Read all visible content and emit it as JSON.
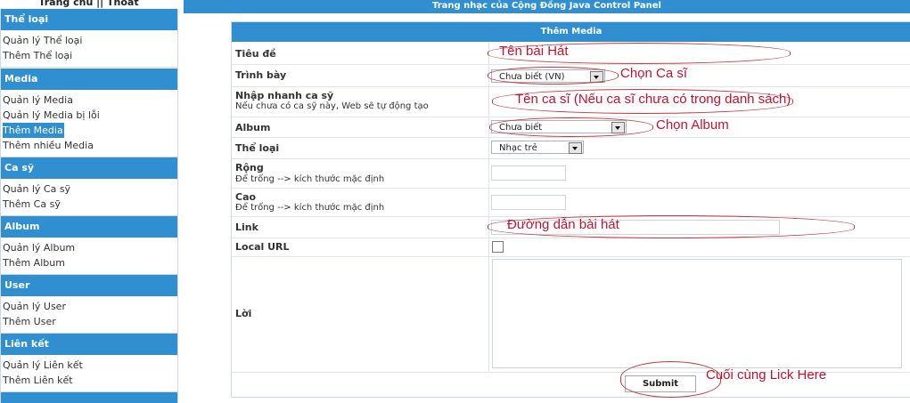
{
  "topnav": {
    "home": "Trang chủ",
    "sep": " || ",
    "logout": "Thoát"
  },
  "sidebar": {
    "sections": [
      {
        "title": "Thể loại",
        "items": [
          "Quản lý Thể loại",
          "Thêm Thể loại"
        ]
      },
      {
        "title": "Media",
        "items": [
          "Quản lý Media",
          "Quản lý Media bị lỗi",
          "Thêm Media",
          "Thêm nhiều Media"
        ],
        "active": "Thêm Media"
      },
      {
        "title": "Ca sỹ",
        "items": [
          "Quản lý Ca sỹ",
          "Thêm Ca sỹ"
        ]
      },
      {
        "title": "Album",
        "items": [
          "Quản lý Album",
          "Thêm Album"
        ]
      },
      {
        "title": "User",
        "items": [
          "Quản lý User",
          "Thêm User"
        ]
      },
      {
        "title": "Liên kết",
        "items": [
          "Quản lý Liên kết",
          "Thêm Liên kết"
        ]
      }
    ]
  },
  "header": {
    "title": "Trang nhạc của Cộng Đồng Java Control Panel"
  },
  "form": {
    "title": "Thêm Media",
    "labels": {
      "title": "Tiêu đề",
      "presenter": "Trình bày",
      "quick_singer": "Nhập nhanh ca sỹ",
      "quick_singer_hint": "Nếu chưa có ca sỹ này, Web sẽ tự động tạo",
      "album": "Album",
      "genre": "Thể loại",
      "width": "Rộng",
      "width_hint": "Để trống --> kích thước mặc định",
      "height": "Cao",
      "height_hint": "Để trống --> kích thước mặc định",
      "link": "Link",
      "local_url": "Local URL",
      "lyrics": "Lời"
    },
    "values": {
      "presenter": "Chưa biết (VN)",
      "album": "Chưa biết",
      "genre": "Nhạc trẻ"
    },
    "submit": "Submit"
  },
  "annotations": {
    "title_note": "Tên bài Hát",
    "singer_note": "Chọn Ca sĩ",
    "quick_note": "Tên ca sĩ (Nếu ca sĩ chưa có trong danh sách)",
    "album_note": "Chọn Album",
    "link_note": "Đường dẫn bài hát",
    "submit_note": "Cuối cùng Lick Here"
  },
  "colors": {
    "accent": "#2f8fd0",
    "annotation": "#c8102e"
  }
}
